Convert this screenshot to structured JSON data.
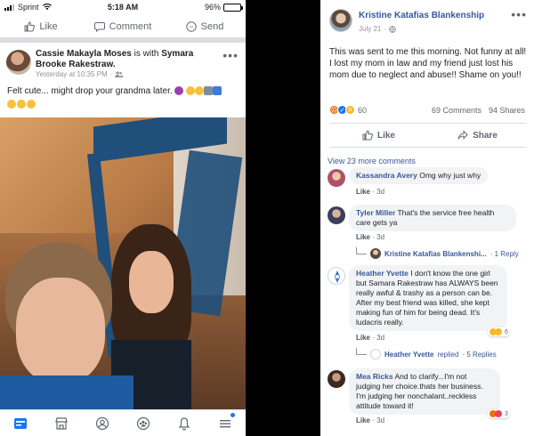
{
  "phone": {
    "status": {
      "carrier": "Sprint",
      "time": "5:18 AM",
      "battery": "96%"
    },
    "actions": {
      "like": "Like",
      "comment": "Comment",
      "send": "Send"
    },
    "post": {
      "author": "Cassie Makayla Moses",
      "with_text": "is with",
      "tagged": "Symara Brooke Rakestraw.",
      "time": "Yesterday at 10:35 PM",
      "text": "Felt cute... might drop your grandma later."
    },
    "tabs": [
      "news-feed",
      "marketplace",
      "profile",
      "groups",
      "notifications",
      "menu"
    ]
  },
  "desktop": {
    "post": {
      "author": "Kristine Katafias Blankenship",
      "date": "July 21",
      "text": "This was sent to me this morning. Not funny at all! I lost my mom in law and my friend just lost his mom due to neglect and abuse!! Shame on you!!",
      "reaction_count": "60",
      "comments_count": "69 Comments",
      "shares_count": "94 Shares"
    },
    "actions": {
      "like": "Like",
      "share": "Share"
    },
    "view_more": "View 23 more comments",
    "comments": [
      {
        "name": "Kassandra Avery",
        "text": "Omg why just why",
        "like": "Like",
        "time": "3d"
      },
      {
        "name": "Tyler Miller",
        "text": "That's the service free health care gets ya",
        "like": "Like",
        "time": "3d",
        "reply": {
          "name": "Kristine Katafias Blankenshi...",
          "count": "· 1 Reply"
        }
      },
      {
        "name": "Heather Yvette",
        "text": "I don't know the one girl but Samara Rakestraw has ALWAYS been really awful & trashy as a person can be. After my best friend was killed, she kept making fun of him for being dead. It's ludacris really.",
        "like": "Like",
        "time": "3d",
        "reactions": "6",
        "reply": {
          "name": "Heather Yvette",
          "verb": "replied",
          "count": "· 5 Replies"
        }
      },
      {
        "name": "Mea Ricks",
        "text": "And to clarify...I'm not judging her choice.thats her business. I'm judging her nonchalant..reckless attitude toward it!",
        "like": "Like",
        "time": "3d",
        "reactions": "3"
      }
    ]
  },
  "colors": {
    "fb_blue": "#385898",
    "link_blue": "#1877f2",
    "divider": "#dadde1",
    "bubble": "#f2f3f5"
  }
}
